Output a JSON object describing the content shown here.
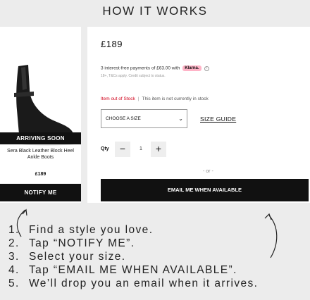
{
  "header": {
    "title": "HOW IT WORKS"
  },
  "card": {
    "badge": "ARRIVING SOON",
    "name": "Sera Black Leather Block Heel Ankle Boots",
    "price": "£189",
    "notify_label": "NOTIFY ME"
  },
  "product": {
    "price": "£189",
    "klarna_text": "3 interest-free payments of £63.00 with",
    "klarna_badge": "Klarna.",
    "klarna_info": "i",
    "fine_print": "18+, T&Cs apply. Credit subject to status.",
    "stock_status": "Item out of Stock",
    "stock_separator": "|",
    "stock_note": "This item is not currently in stock",
    "size_select_value": "CHOOSE A SIZE",
    "size_guide_label": "SIZE GUIDE",
    "qty_label": "Qty",
    "qty_minus": "−",
    "qty_value": "1",
    "qty_plus": "+",
    "or_text": "- or -",
    "email_label": "EMAIL ME WHEN AVAILABLE"
  },
  "steps": [
    {
      "num": "1.",
      "text": "Find a style you love."
    },
    {
      "num": "2.",
      "text": "Tap “NOTIFY ME”."
    },
    {
      "num": "3.",
      "text": "Select your size."
    },
    {
      "num": "4.",
      "text": "Tap “EMAIL ME WHEN AVAILABLE”."
    },
    {
      "num": "5.",
      "text": "We’ll drop you an email when it arrives."
    }
  ],
  "colors": {
    "accent": "#111111",
    "out_of_stock": "#d0021b",
    "klarna": "#ffb3c7",
    "background": "#ececec"
  }
}
